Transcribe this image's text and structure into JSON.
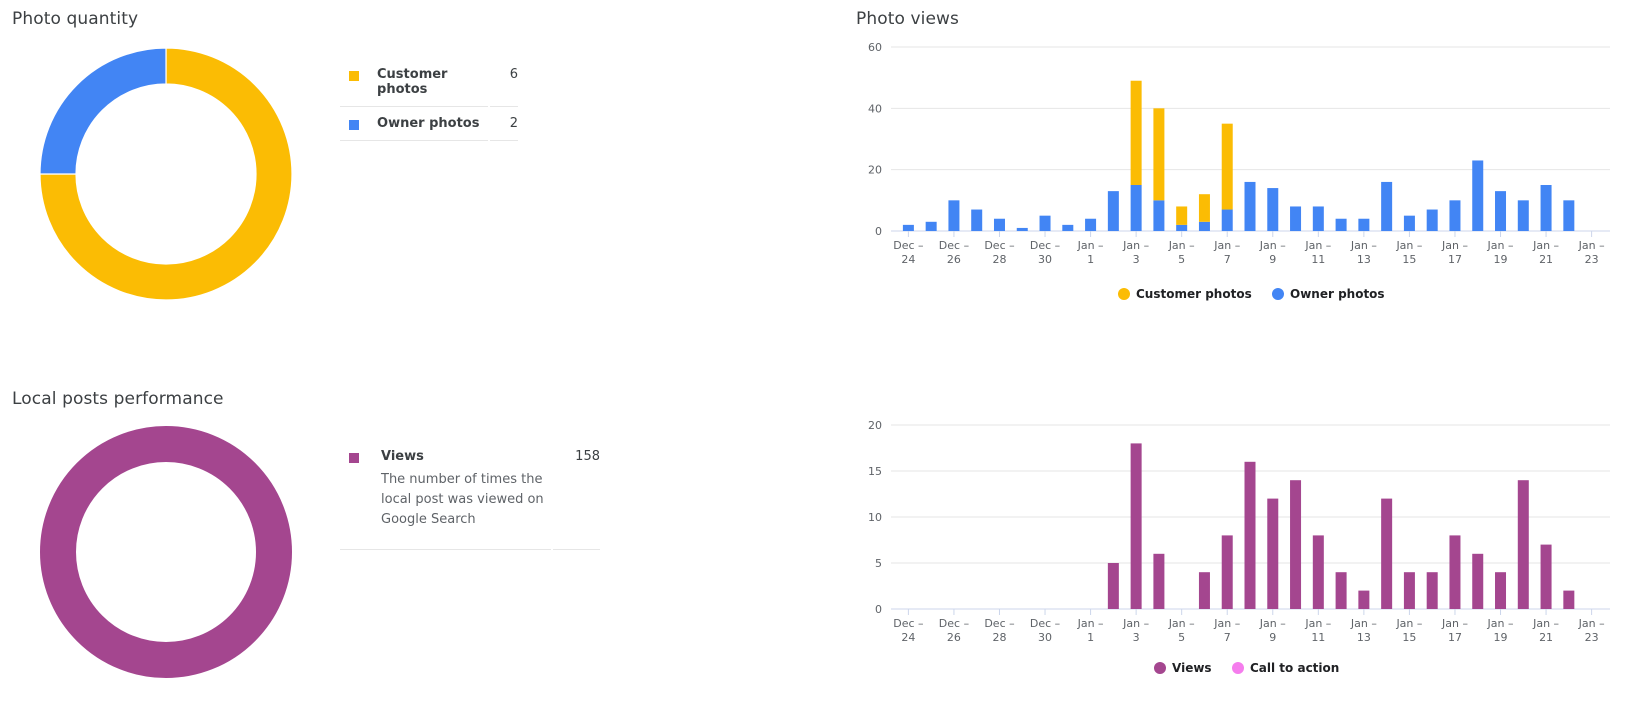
{
  "photo_quantity": {
    "title": "Photo quantity",
    "legend": [
      {
        "label": "Customer photos",
        "value": "6",
        "color": "#fbbc04"
      },
      {
        "label": "Owner photos",
        "value": "2",
        "color": "#4285f4"
      }
    ]
  },
  "photo_views": {
    "title": "Photo views",
    "legend": [
      {
        "label": "Customer photos",
        "color": "#fbbc04"
      },
      {
        "label": "Owner photos",
        "color": "#4285f4"
      }
    ]
  },
  "local_posts": {
    "title": "Local posts performance",
    "legend": [
      {
        "label": "Views",
        "value": "158",
        "description": "The number of times the local post was viewed on Google Search",
        "color": "#a4468f"
      }
    ],
    "chart_legend": [
      {
        "label": "Views",
        "color": "#a4468f"
      },
      {
        "label": "Call to action",
        "color": "#f57ded"
      }
    ]
  },
  "chart_data": [
    {
      "type": "pie",
      "title": "Photo quantity",
      "donut": true,
      "categories": [
        "Customer photos",
        "Owner photos"
      ],
      "values": [
        6,
        2
      ],
      "colors": [
        "#fbbc04",
        "#4285f4"
      ],
      "legend": "right"
    },
    {
      "type": "bar",
      "stacked": true,
      "title": "Photo views",
      "categories": [
        "Dec 24",
        "Dec 25",
        "Dec 26",
        "Dec 27",
        "Dec 28",
        "Dec 29",
        "Dec 30",
        "Dec 31",
        "Jan 1",
        "Jan 2",
        "Jan 3",
        "Jan 4",
        "Jan 5",
        "Jan 6",
        "Jan 7",
        "Jan 8",
        "Jan 9",
        "Jan 10",
        "Jan 11",
        "Jan 12",
        "Jan 13",
        "Jan 14",
        "Jan 15",
        "Jan 16",
        "Jan 17",
        "Jan 18",
        "Jan 19",
        "Jan 20",
        "Jan 21",
        "Jan 22",
        "Jan 23"
      ],
      "tick_labels": [
        [
          "Dec –",
          "24"
        ],
        [
          "Dec –",
          "26"
        ],
        [
          "Dec –",
          "28"
        ],
        [
          "Dec –",
          "30"
        ],
        [
          "Jan –",
          "1"
        ],
        [
          "Jan –",
          "3"
        ],
        [
          "Jan –",
          "5"
        ],
        [
          "Jan –",
          "7"
        ],
        [
          "Jan –",
          "9"
        ],
        [
          "Jan –",
          "11"
        ],
        [
          "Jan –",
          "13"
        ],
        [
          "Jan –",
          "15"
        ],
        [
          "Jan –",
          "17"
        ],
        [
          "Jan –",
          "19"
        ],
        [
          "Jan –",
          "21"
        ],
        [
          "Jan –",
          "23"
        ]
      ],
      "series": [
        {
          "name": "Owner photos",
          "color": "#4285f4",
          "values": [
            2,
            3,
            10,
            7,
            4,
            1,
            5,
            2,
            4,
            13,
            15,
            10,
            2,
            3,
            7,
            16,
            14,
            8,
            8,
            4,
            4,
            16,
            5,
            7,
            10,
            23,
            13,
            10,
            15,
            10,
            0
          ]
        },
        {
          "name": "Customer photos",
          "color": "#fbbc04",
          "values": [
            0,
            0,
            0,
            0,
            0,
            0,
            0,
            0,
            0,
            0,
            34,
            30,
            6,
            9,
            28,
            0,
            0,
            0,
            0,
            0,
            0,
            0,
            0,
            0,
            0,
            0,
            0,
            0,
            0,
            0,
            0
          ]
        }
      ],
      "yticks": [
        0,
        20,
        40,
        60
      ],
      "ylim": [
        0,
        60
      ],
      "grid": true,
      "legend": "bottom"
    },
    {
      "type": "pie",
      "title": "Local posts performance",
      "donut": true,
      "categories": [
        "Views"
      ],
      "values": [
        158
      ],
      "colors": [
        "#a4468f"
      ],
      "legend": "right"
    },
    {
      "type": "bar",
      "stacked": true,
      "title": "",
      "categories": [
        "Dec 24",
        "Dec 25",
        "Dec 26",
        "Dec 27",
        "Dec 28",
        "Dec 29",
        "Dec 30",
        "Dec 31",
        "Jan 1",
        "Jan 2",
        "Jan 3",
        "Jan 4",
        "Jan 5",
        "Jan 6",
        "Jan 7",
        "Jan 8",
        "Jan 9",
        "Jan 10",
        "Jan 11",
        "Jan 12",
        "Jan 13",
        "Jan 14",
        "Jan 15",
        "Jan 16",
        "Jan 17",
        "Jan 18",
        "Jan 19",
        "Jan 20",
        "Jan 21",
        "Jan 22",
        "Jan 23"
      ],
      "tick_labels": [
        [
          "Dec –",
          "24"
        ],
        [
          "Dec –",
          "26"
        ],
        [
          "Dec –",
          "28"
        ],
        [
          "Dec –",
          "30"
        ],
        [
          "Jan –",
          "1"
        ],
        [
          "Jan –",
          "3"
        ],
        [
          "Jan –",
          "5"
        ],
        [
          "Jan –",
          "7"
        ],
        [
          "Jan –",
          "9"
        ],
        [
          "Jan –",
          "11"
        ],
        [
          "Jan –",
          "13"
        ],
        [
          "Jan –",
          "15"
        ],
        [
          "Jan –",
          "17"
        ],
        [
          "Jan –",
          "19"
        ],
        [
          "Jan –",
          "21"
        ],
        [
          "Jan –",
          "23"
        ]
      ],
      "series": [
        {
          "name": "Views",
          "color": "#a4468f",
          "values": [
            0,
            0,
            0,
            0,
            0,
            0,
            0,
            0,
            0,
            5,
            18,
            6,
            0,
            4,
            8,
            16,
            12,
            14,
            8,
            4,
            2,
            12,
            4,
            4,
            8,
            6,
            4,
            14,
            7,
            2,
            0
          ]
        },
        {
          "name": "Call to action",
          "color": "#f57ded",
          "values": [
            0,
            0,
            0,
            0,
            0,
            0,
            0,
            0,
            0,
            0,
            0,
            0,
            0,
            0,
            0,
            0,
            0,
            0,
            0,
            0,
            0,
            0,
            0,
            0,
            0,
            0,
            0,
            0,
            0,
            0,
            0
          ]
        }
      ],
      "yticks": [
        0,
        5,
        10,
        15,
        20
      ],
      "ylim": [
        0,
        20
      ],
      "grid": true,
      "legend": "bottom"
    }
  ]
}
